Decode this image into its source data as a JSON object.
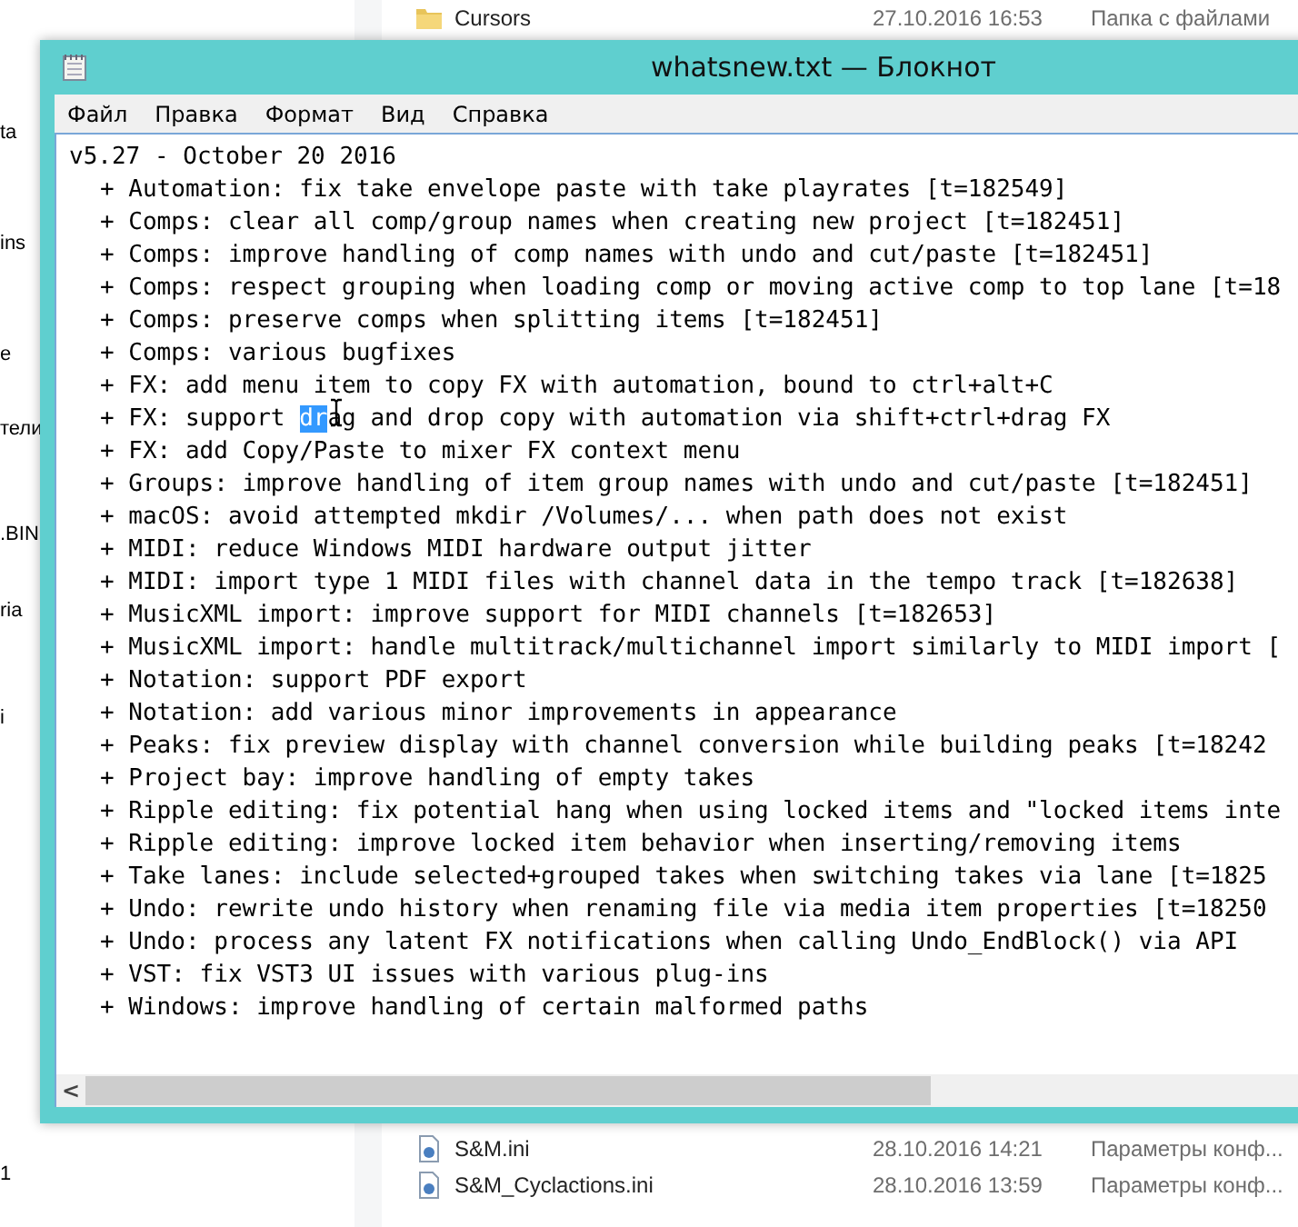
{
  "explorer": {
    "nav_items": [
      "ta",
      "ins",
      "e",
      "тели",
      ".BIN",
      "ria",
      "i",
      "1"
    ],
    "files_top": [
      {
        "kind": "folder",
        "name": "Cursors",
        "date": "27.10.2016 16:53",
        "type": "Папка с файлами"
      }
    ],
    "files_bottom": [
      {
        "kind": "ini",
        "name": "S&M.ini",
        "date": "28.10.2016 14:21",
        "type": "Параметры конф..."
      },
      {
        "kind": "ini",
        "name": "S&M_Cyclactions.ini",
        "date": "28.10.2016 13:59",
        "type": "Параметры конф..."
      }
    ]
  },
  "window": {
    "title": "whatsnew.txt — Блокнот",
    "menu": [
      "Файл",
      "Правка",
      "Формат",
      "Вид",
      "Справка"
    ],
    "heading": "v5.27 - October 20 2016",
    "items": [
      [
        {
          "text": "+ Automation: fix take envelope paste with take playrates [t=182549]",
          "selected": false
        }
      ],
      [
        {
          "text": "+ Comps: clear all comp/group names when creating new project [t=182451]",
          "selected": false
        }
      ],
      [
        {
          "text": "+ Comps: improve handling of comp names with undo and cut/paste [t=182451]",
          "selected": false
        }
      ],
      [
        {
          "text": "+ Comps: respect grouping when loading comp or moving active comp to top lane [t=18",
          "selected": false
        }
      ],
      [
        {
          "text": "+ Comps: preserve comps when splitting items [t=182451]",
          "selected": false
        }
      ],
      [
        {
          "text": "+ Comps: various bugfixes",
          "selected": false
        }
      ],
      [
        {
          "text": "+ FX: add menu item to copy FX with automation, bound to ctrl+alt+C",
          "selected": false
        }
      ],
      [
        {
          "text": "+ FX: support ",
          "selected": false
        },
        {
          "text": "dr",
          "selected": true
        },
        {
          "text": "ag and drop copy with automation via shift+ctrl+drag FX",
          "selected": false
        }
      ],
      [
        {
          "text": "+ FX: add Copy/Paste to mixer FX context menu",
          "selected": false
        }
      ],
      [
        {
          "text": "+ Groups: improve handling of item group names with undo and cut/paste [t=182451]",
          "selected": false
        }
      ],
      [
        {
          "text": "+ macOS: avoid attempted mkdir /Volumes/... when path does not exist",
          "selected": false
        }
      ],
      [
        {
          "text": "+ MIDI: reduce Windows MIDI hardware output jitter",
          "selected": false
        }
      ],
      [
        {
          "text": "+ MIDI: import type 1 MIDI files with channel data in the tempo track [t=182638]",
          "selected": false
        }
      ],
      [
        {
          "text": "+ MusicXML import: improve support for MIDI channels [t=182653]",
          "selected": false
        }
      ],
      [
        {
          "text": "+ MusicXML import: handle multitrack/multichannel import similarly to MIDI import [",
          "selected": false
        }
      ],
      [
        {
          "text": "+ Notation: support PDF export",
          "selected": false
        }
      ],
      [
        {
          "text": "+ Notation: add various minor improvements in appearance",
          "selected": false
        }
      ],
      [
        {
          "text": "+ Peaks: fix preview display with channel conversion while building peaks [t=18242",
          "selected": false
        }
      ],
      [
        {
          "text": "+ Project bay: improve handling of empty takes",
          "selected": false
        }
      ],
      [
        {
          "text": "+ Ripple editing: fix potential hang when using locked items and \"locked items inte",
          "selected": false
        }
      ],
      [
        {
          "text": "+ Ripple editing: improve locked item behavior when inserting/removing items",
          "selected": false
        }
      ],
      [
        {
          "text": "+ Take lanes: include selected+grouped takes when switching takes via lane [t=1825",
          "selected": false
        }
      ],
      [
        {
          "text": "+ Undo: rewrite undo history when renaming file via media item properties [t=18250",
          "selected": false
        }
      ],
      [
        {
          "text": "+ Undo: process any latent FX notifications when calling Undo_EndBlock() via API",
          "selected": false
        }
      ],
      [
        {
          "text": "+ VST: fix VST3 UI issues with various plug-ins",
          "selected": false
        }
      ],
      [
        {
          "text": "+ Windows: improve handling of certain malformed paths",
          "selected": false
        }
      ]
    ],
    "scroll_arrow": "<"
  }
}
